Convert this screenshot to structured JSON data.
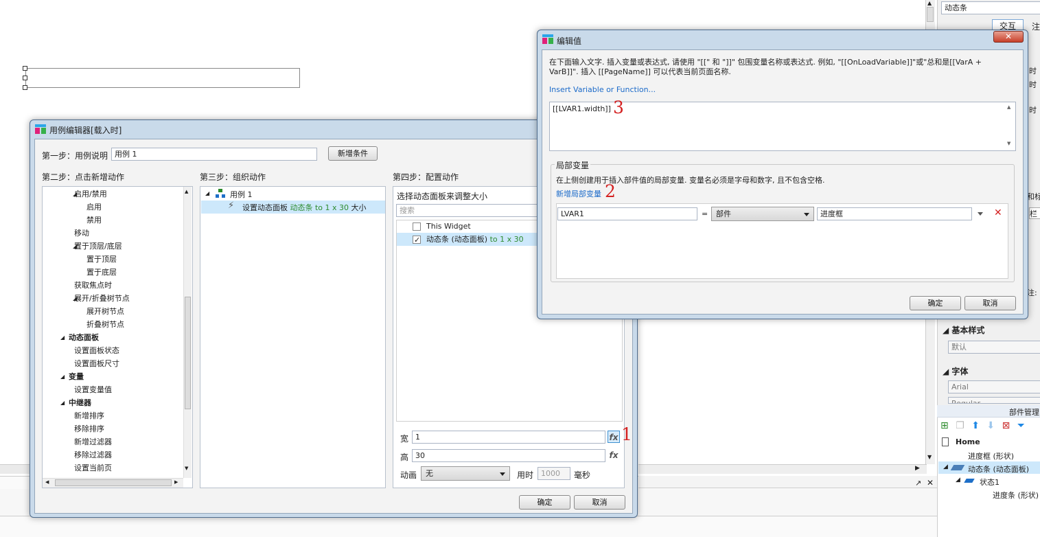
{
  "right_panel": {
    "top_input": "动态条",
    "tab_interaction": "交互",
    "tab_note_partial": "注",
    "side_text_1": "时",
    "side_text_2": "时",
    "side_text_3": "时",
    "side_text_4": "和标",
    "side_text_5": "栏",
    "side_text_6": "注:",
    "base_style_header": "基本样式",
    "base_style_value": "默认",
    "font_header": "字体",
    "font_value": "Arial",
    "font_value2": "Regular"
  },
  "widget_manager": {
    "title": "部件管理",
    "tree": [
      {
        "label": "Home",
        "level": 0
      },
      {
        "label": "进度框 (形状)",
        "level": 1
      },
      {
        "label": "动态条 (动态面板)",
        "level": 1
      },
      {
        "label": "状态1",
        "level": 2
      },
      {
        "label": "进度条 (形状)",
        "level": 3
      }
    ]
  },
  "case_editor": {
    "title": "用例编辑器[载入时]",
    "step1_label": "第一步：用例说明",
    "step1_value": "用例 1",
    "add_condition": "新增条件",
    "step2_label": "第二步：点击新增动作",
    "step3_label": "第三步：组织动作",
    "step4_label": "第四步：配置动作",
    "actions": [
      {
        "label": "启用/禁用",
        "level": 1,
        "group": true
      },
      {
        "label": "启用",
        "level": 2
      },
      {
        "label": "禁用",
        "level": 2
      },
      {
        "label": "移动",
        "level": 1
      },
      {
        "label": "置于顶层/底层",
        "level": 1,
        "group": true
      },
      {
        "label": "置于顶层",
        "level": 2
      },
      {
        "label": "置于底层",
        "level": 2
      },
      {
        "label": "获取焦点时",
        "level": 1
      },
      {
        "label": "展开/折叠树节点",
        "level": 1,
        "group": true
      },
      {
        "label": "展开树节点",
        "level": 2
      },
      {
        "label": "折叠树节点",
        "level": 2
      },
      {
        "label": "动态面板",
        "level": 0,
        "group": true
      },
      {
        "label": "设置面板状态",
        "level": 1
      },
      {
        "label": "设置面板尺寸",
        "level": 1
      },
      {
        "label": "变量",
        "level": 0,
        "group": true
      },
      {
        "label": "设置变量值",
        "level": 1
      },
      {
        "label": "中继器",
        "level": 0,
        "group": true
      },
      {
        "label": "新增排序",
        "level": 1
      },
      {
        "label": "移除排序",
        "level": 1
      },
      {
        "label": "新增过滤器",
        "level": 1
      },
      {
        "label": "移除过滤器",
        "level": 1
      },
      {
        "label": "设置当前页",
        "level": 1
      }
    ],
    "case_name": "用例 1",
    "organized_action_prefix": "设置动态面板 ",
    "organized_action_target": "动态条 to 1 x 30",
    "organized_action_suffix": " 大小",
    "config_hint": "选择动态面板来调整大小",
    "search_placeholder": "搜索",
    "widget_this": "This Widget",
    "widget_dyn": "动态条 (动态面板) ",
    "widget_dyn_size": "to 1 x 30",
    "width_label": "宽",
    "width_value": "1",
    "height_label": "高",
    "height_value": "30",
    "fx": "fx",
    "anim_label": "动画",
    "anim_value": "无",
    "time_label": "用时",
    "time_value": "1000",
    "ms_label": "毫秒",
    "ok": "确定",
    "cancel": "取消"
  },
  "edit_value": {
    "title": "编辑值",
    "instruction": "在下面输入文字. 插入变量或表达式, 请使用 \"[[\" 和 \"]]\" 包围变量名称或表达式. 例如, \"[[OnLoadVariable]]\"或\"总和是[[VarA + VarB]]\". 插入 [[PageName]] 可以代表当前页面名称.",
    "insert_link": "Insert Variable or Function...",
    "expression": "[[LVAR1.width]]",
    "local_var_group": "局部变量",
    "local_var_desc": "在上侧创建用于插入部件值的局部变量. 变量名必须是字母和数字, 且不包含空格.",
    "add_local_var": "新增局部变量",
    "var_name": "LVAR1",
    "equals": "=",
    "var_type": "部件",
    "var_target": "进度框",
    "ok": "确定",
    "cancel": "取消"
  },
  "annotations": {
    "one": "1",
    "two": "2",
    "three": "3"
  },
  "colors": {
    "selection": "#cde8fb",
    "green_text": "#2e8b2e",
    "annotation_red": "#d42020",
    "title_bar": "#c9daea"
  }
}
